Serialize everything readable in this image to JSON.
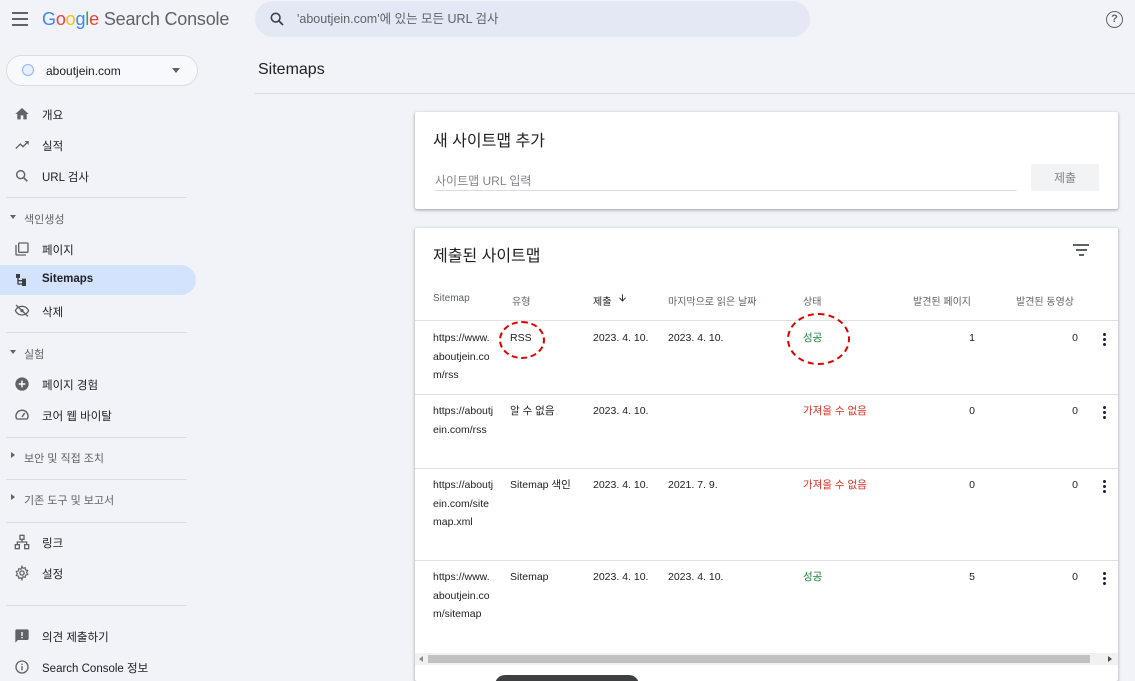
{
  "header": {
    "logo_letters": [
      "G",
      "o",
      "o",
      "g",
      "l",
      "e"
    ],
    "product": "Search Console",
    "search_placeholder": "'aboutjein.com'에 있는 모든 URL 검사"
  },
  "sidebar": {
    "property": "aboutjein.com",
    "nav_top": [
      {
        "label": "개요",
        "icon": "home-icon"
      },
      {
        "label": "실적",
        "icon": "trending-up-icon"
      },
      {
        "label": "URL 검사",
        "icon": "search-icon"
      }
    ],
    "indexing": {
      "section": "색인생성",
      "items": [
        {
          "label": "페이지",
          "icon": "pages-icon"
        },
        {
          "label": "Sitemaps",
          "icon": "sitemap-icon"
        },
        {
          "label": "삭제",
          "icon": "visibility-off-icon"
        }
      ]
    },
    "experience": {
      "section": "실험",
      "items": [
        {
          "label": "페이지 경험",
          "icon": "add-circle-icon"
        },
        {
          "label": "코어 웹 바이탈",
          "icon": "speed-icon"
        }
      ]
    },
    "security_section": "보안 및 직접 조치",
    "legacy_section": "기존 도구 및 보고서",
    "nav_bottom": [
      {
        "label": "링크",
        "icon": "links-icon"
      },
      {
        "label": "설정",
        "icon": "settings-icon"
      }
    ],
    "footer": [
      {
        "label": "의견 제출하기",
        "icon": "feedback-icon"
      },
      {
        "label": "Search Console 정보",
        "icon": "info-icon"
      }
    ]
  },
  "main": {
    "title": "Sitemaps",
    "add_card": {
      "title": "새 사이트맵 추가",
      "input_placeholder": "사이트맵 URL 입력",
      "submit": "제출"
    },
    "list_card": {
      "title": "제출된 사이트맵",
      "columns": [
        "Sitemap",
        "유형",
        "제출",
        "마지막으로 읽은 날짜",
        "상태",
        "발견된 페이지",
        "발견된 동영상"
      ],
      "sort_column": "제출",
      "sort_direction": "descending",
      "rows": [
        {
          "url": "https://www.aboutjein.com/rss",
          "type": "RSS",
          "submitted": "2023. 4. 10.",
          "last_read": "2023. 4. 10.",
          "status": "성공",
          "status_kind": "ok",
          "pages": "1",
          "videos": "0"
        },
        {
          "url": "https://aboutjein.com/rss",
          "type": "알 수 없음",
          "submitted": "2023. 4. 10.",
          "last_read": "",
          "status": "가져올 수 없음",
          "status_kind": "err",
          "pages": "0",
          "videos": "0"
        },
        {
          "url": "https://aboutjein.com/sitemap.xml",
          "type": "Sitemap 색인",
          "submitted": "2023. 4. 10.",
          "last_read": "2021. 7. 9.",
          "status": "가져올 수 없음",
          "status_kind": "err",
          "pages": "0",
          "videos": "0"
        },
        {
          "url": "https://www.aboutjein.com/sitemap",
          "type": "Sitemap",
          "submitted": "2023. 4. 10.",
          "last_read": "2023. 4. 10.",
          "status": "성공",
          "status_kind": "ok",
          "pages": "5",
          "videos": "0"
        }
      ]
    }
  },
  "colors": {
    "accent_active": "#d3e3fd",
    "success": "#188038",
    "error": "#d93025",
    "annotation": "#e00000"
  }
}
